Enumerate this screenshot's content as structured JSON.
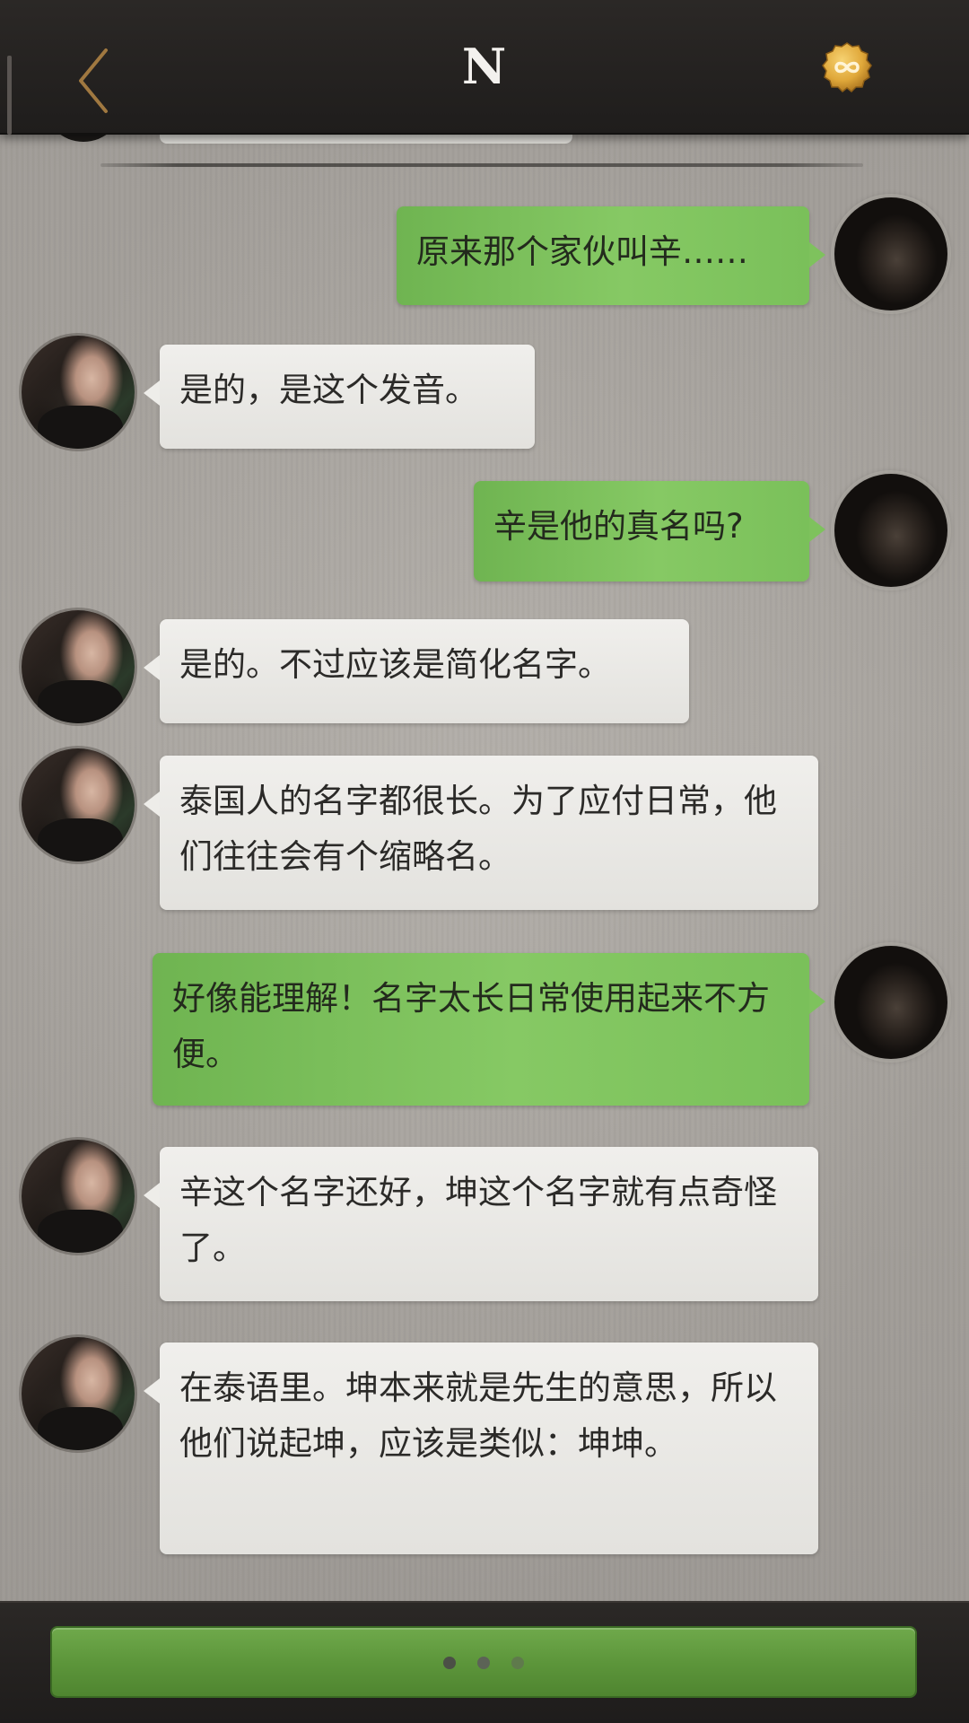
{
  "header": {
    "title": "N",
    "back_icon": "chevron-left-icon",
    "coin_icon": "infinity-coin-icon",
    "coin_color": "#e0a83a"
  },
  "messages": [
    {
      "side": "out",
      "text": "原来那个家伙叫辛……"
    },
    {
      "side": "in",
      "text": "是的，是这个发音。"
    },
    {
      "side": "out",
      "text": "辛是他的真名吗?"
    },
    {
      "side": "in",
      "text": "是的。不过应该是简化名字。"
    },
    {
      "side": "in",
      "text": "泰国人的名字都很长。为了应付日常，他们往往会有个缩略名。"
    },
    {
      "side": "out",
      "text": "好像能理解！名字太长日常使用起来不方便。"
    },
    {
      "side": "in",
      "text": "辛这个名字还好，坤这个名字就有点奇怪了。"
    },
    {
      "side": "in",
      "text": "在泰语里。坤本来就是先生的意思，所以他们说起坤，应该是类似：坤坤。"
    }
  ],
  "footer": {
    "reply_button_icon": "typing-dots-icon",
    "accent_color": "#64a042"
  }
}
